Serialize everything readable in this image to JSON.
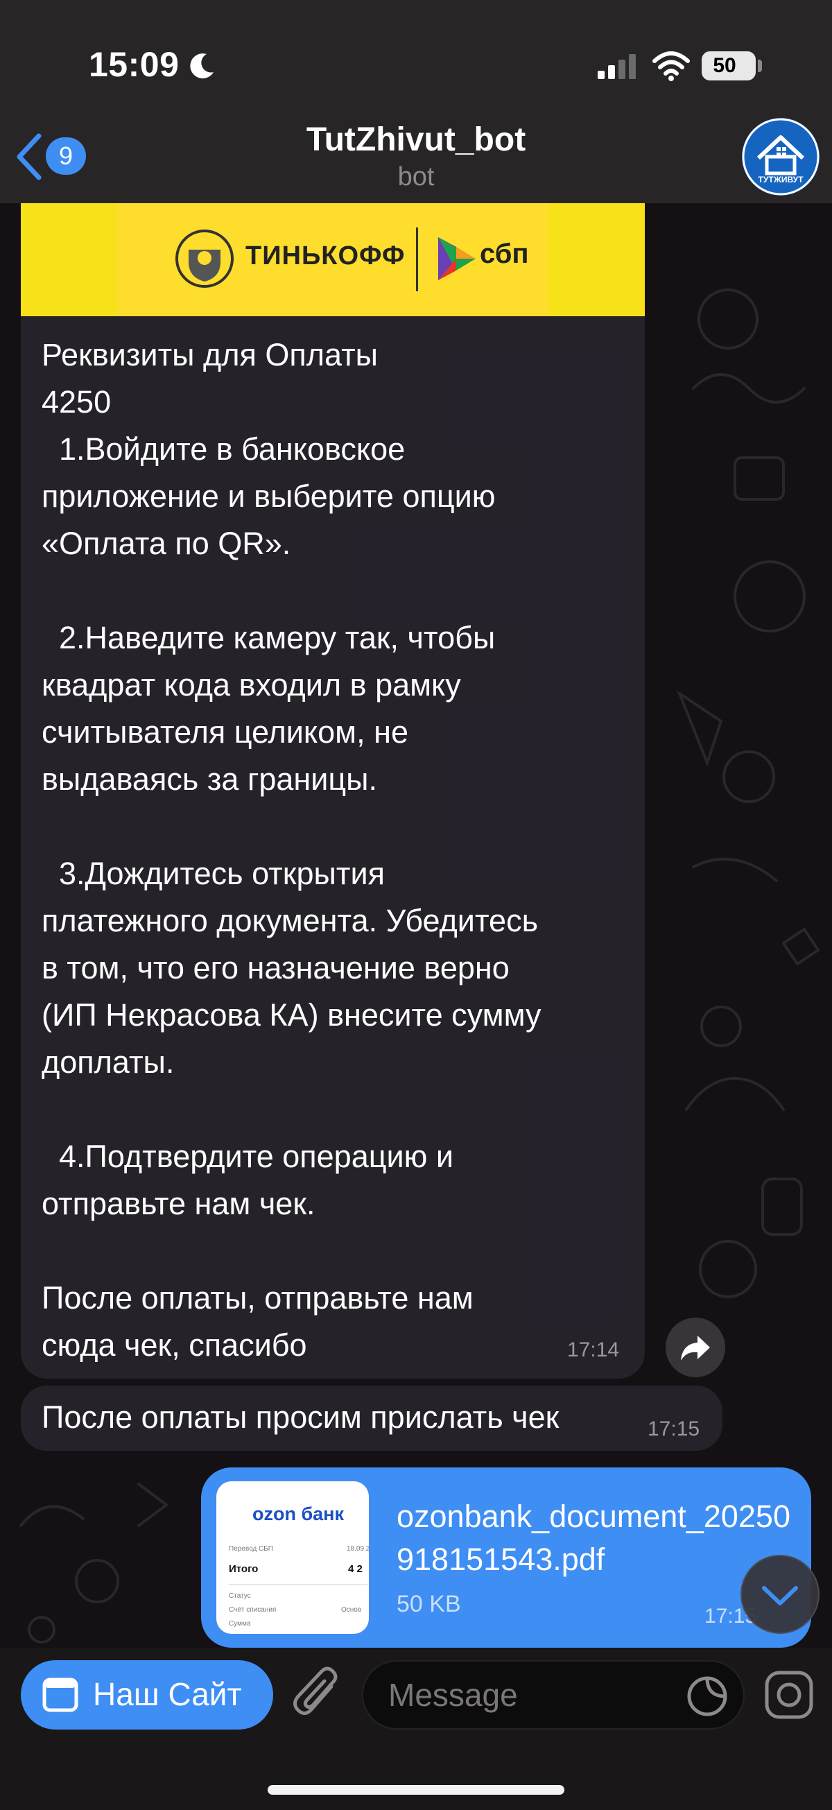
{
  "status_bar": {
    "time": "15:09",
    "battery": "50"
  },
  "header": {
    "back_badge": "9",
    "title": "TutZhivut_bot",
    "subtitle": "bot",
    "avatar_label": "ТУТЖИВУТ"
  },
  "messages": {
    "main": {
      "banner_brand_left": "ТИНЬКОФФ",
      "banner_brand_right": "сбп",
      "text": "Реквизиты для Оплаты\n4250\n  1.Войдите в банковское\nприложение и выберите опцию\n«Оплата по QR».\n\n  2.Наведите камеру так, чтобы\nквадрат кода входил в рамку\nсчитывателя целиком, не\nвыдаваясь за границы.\n\n  3.Дождитесь открытия\nплатежного документа. Убедитесь\nв том, что его назначение верно\n(ИП Некрасова КА) внесите сумму\nдоплаты.\n\n  4.Подтвердите операцию и\nотправьте нам чек.\n\nПосле оплаты, отправьте нам\nсюда чек, спасибо",
      "time": "17:14"
    },
    "second": {
      "text": "После оплаты просим прислать чек",
      "time": "17:15"
    },
    "file": {
      "thumb_logo": "ozon банк",
      "thumb_line1_left": "Перевод СБП",
      "thumb_line1_right": "18.09.2",
      "thumb_total_label": "Итого",
      "thumb_total_value": "4 2",
      "thumb_status": "Статус",
      "thumb_account": "Счёт списания",
      "thumb_account_value": "Основ",
      "thumb_sum": "Сумма",
      "name": "ozonbank_document_20250918151543.pdf",
      "size": "50 KB",
      "time": "17:15"
    }
  },
  "input_bar": {
    "site_button_label": "Наш Сайт",
    "message_placeholder": "Message"
  },
  "colors": {
    "accent": "#3e8ef4",
    "bubble": "#27232c",
    "banner_yellow": "#ffdd2d"
  }
}
